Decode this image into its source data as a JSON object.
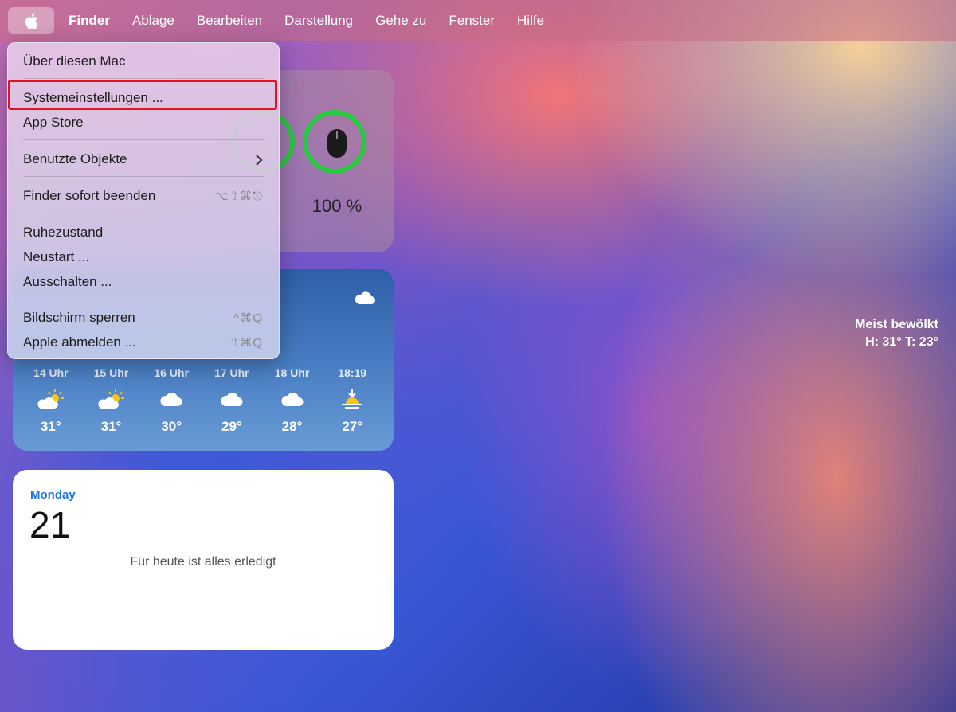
{
  "menubar": {
    "apple_icon": "apple-logo-icon",
    "items": [
      "Finder",
      "Ablage",
      "Bearbeiten",
      "Darstellung",
      "Gehe zu",
      "Fenster",
      "Hilfe"
    ]
  },
  "apple_menu": {
    "about": "Über diesen Mac",
    "settings": "Systemeinstellungen ...",
    "app_store": "App Store",
    "recent": "Benutzte Objekte",
    "force_quit": "Finder sofort beenden",
    "force_quit_shortcut": "⌥⇧⌘⎋",
    "sleep": "Ruhezustand",
    "restart": "Neustart ...",
    "shutdown": "Ausschalten ...",
    "lock": "Bildschirm sperren",
    "lock_shortcut": "^⌘Q",
    "logout": "Apple abmelden ...",
    "logout_shortcut": "⇧⌘Q"
  },
  "battery_widget": {
    "device_icon": "mouse-icon",
    "percent": "100 %",
    "level": 1.0
  },
  "weather_widget": {
    "condition": "Meist bewölkt",
    "high_low": "H: 31° T: 23°",
    "hours": [
      {
        "label": "14 Uhr",
        "icon": "partly-sunny-icon",
        "temp": "31°"
      },
      {
        "label": "15 Uhr",
        "icon": "partly-sunny-icon",
        "temp": "31°"
      },
      {
        "label": "16 Uhr",
        "icon": "cloud-icon",
        "temp": "30°"
      },
      {
        "label": "17 Uhr",
        "icon": "cloud-icon",
        "temp": "29°"
      },
      {
        "label": "18 Uhr",
        "icon": "cloud-icon",
        "temp": "28°"
      },
      {
        "label": "18:19",
        "icon": "sunset-icon",
        "temp": "27°"
      }
    ]
  },
  "calendar_widget": {
    "weekday": "Monday",
    "day": "21",
    "empty_text": "Für heute ist alles erledigt"
  },
  "colors": {
    "highlight": "#e0151b",
    "ring": "#27c93f",
    "calendar_accent": "#1a73e8"
  }
}
